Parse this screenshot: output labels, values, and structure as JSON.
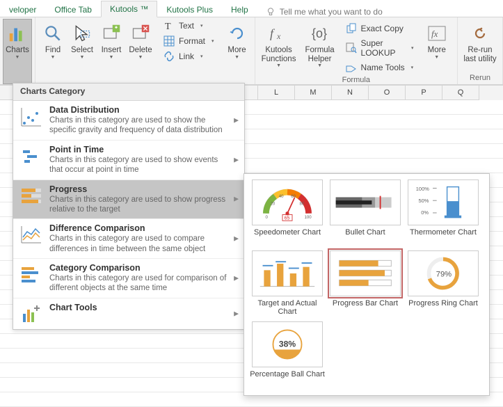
{
  "tabs": {
    "developer": "veloper",
    "office_tab": "Office Tab",
    "kutools": "Kutools ™",
    "kutools_plus": "Kutools Plus",
    "help": "Help",
    "tell_me": "Tell me what you want to do"
  },
  "ribbon": {
    "charts": "Charts",
    "find": "Find",
    "select": "Select",
    "insert": "Insert",
    "delete": "Delete",
    "text": "Text",
    "format": "Format",
    "link": "Link",
    "more": "More",
    "functions": "Kutools Functions",
    "helper": "Formula Helper",
    "exact_copy": "Exact Copy",
    "super_lookup": "Super LOOKUP",
    "name_tools": "Name Tools",
    "more2": "More",
    "rerun": "Re-run last utility",
    "group_formula": "Formula",
    "group_rerun": "Rerun"
  },
  "panel": {
    "header": "Charts Category",
    "items": [
      {
        "title": "Data Distribution",
        "desc": "Charts in this category are used to show the specific gravity and frequency of data distribution"
      },
      {
        "title": "Point in Time",
        "desc": "Charts in this category are used to show events that occur at point in time"
      },
      {
        "title": "Progress",
        "desc": "Charts in this category are used to show progress relative to the target"
      },
      {
        "title": "Difference Comparison",
        "desc": "Charts in this category are used to compare differences in time between the same object"
      },
      {
        "title": "Category Comparison",
        "desc": "Charts in this category are used for comparison of different objects at the same time"
      },
      {
        "title": "Chart Tools",
        "desc": ""
      }
    ]
  },
  "fly": {
    "speedo": "Speedometer Chart",
    "speedo_val": "65",
    "bullet": "Bullet Chart",
    "thermo": "Thermometer Chart",
    "thermo_100": "100%",
    "thermo_50": "50%",
    "thermo_0": "0%",
    "target": "Target and Actual Chart",
    "progress_bar": "Progress Bar Chart",
    "ring": "Progress Ring Chart",
    "ring_val": "79%",
    "ball": "Percentage Ball Chart",
    "ball_val": "38%"
  },
  "cols": [
    "L",
    "M",
    "N",
    "O",
    "P",
    "Q"
  ]
}
